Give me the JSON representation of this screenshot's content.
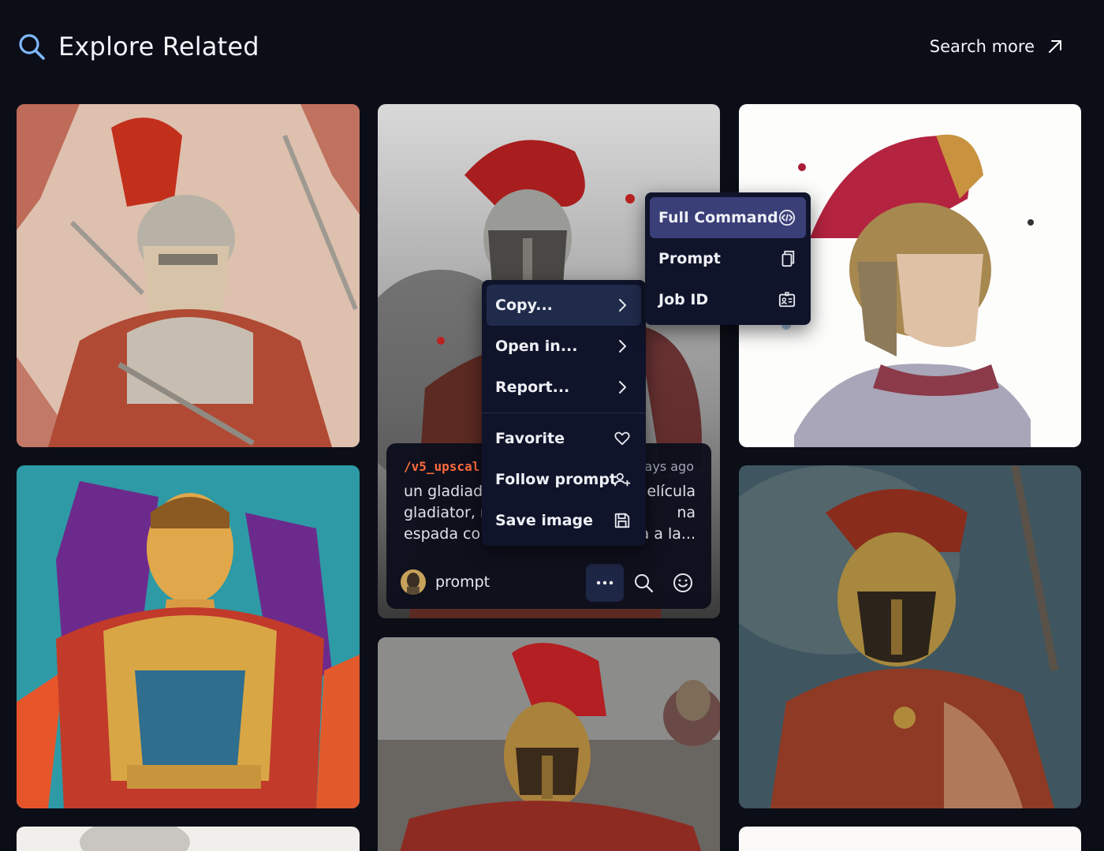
{
  "header": {
    "title": "Explore Related",
    "search_more_label": "Search more"
  },
  "info_panel": {
    "command": "/v5_upscal",
    "time": "ays ago",
    "prompt_lines": [
      {
        "left": "un gladiado",
        "right": "elícula"
      },
      {
        "left": "gladiator, m",
        "right": "na"
      },
      {
        "left": "espada co",
        "right": "a a la..."
      }
    ],
    "username": "prompt"
  },
  "context_menu": {
    "items": [
      {
        "label": "Copy...",
        "icon": "chevron-right-icon",
        "active": true
      },
      {
        "label": "Open in...",
        "icon": "chevron-right-icon"
      },
      {
        "label": "Report...",
        "icon": "chevron-right-icon"
      }
    ],
    "actions": [
      {
        "label": "Favorite",
        "icon": "heart-icon"
      },
      {
        "label": "Follow prompt",
        "icon": "user-plus-icon"
      },
      {
        "label": "Save image",
        "icon": "save-icon"
      }
    ]
  },
  "copy_submenu": {
    "items": [
      {
        "label": "Full Command",
        "icon": "code-icon",
        "active": true
      },
      {
        "label": "Prompt",
        "icon": "copy-icon"
      },
      {
        "label": "Job ID",
        "icon": "id-card-icon"
      }
    ]
  },
  "colors": {
    "background": "#0b0e17",
    "menu_bg": "#10142a",
    "active_item": "#202a4a",
    "submenu_active": "#3b3f78",
    "command_accent": "#ff6a3d",
    "search_icon": "#7fb8ff"
  }
}
